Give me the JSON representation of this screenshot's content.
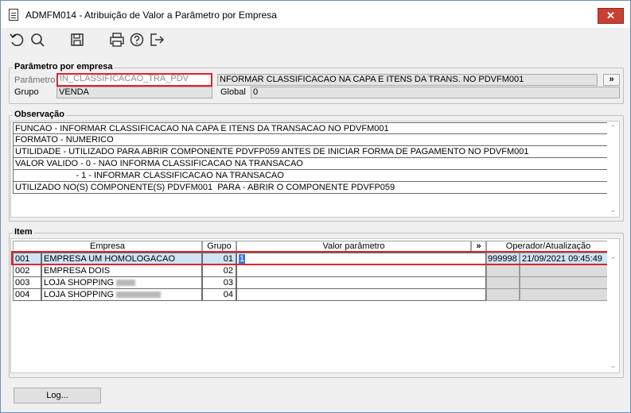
{
  "window": {
    "title": "ADMFM014 - Atribuição de Valor a Parâmetro por Empresa",
    "close_label": "✕"
  },
  "toolbar": {
    "icons": [
      "undo-icon",
      "search-icon",
      "save-icon",
      "print-icon",
      "help-icon",
      "exit-icon"
    ]
  },
  "parametro_section": {
    "title": "Parâmetro por empresa",
    "parametro_label": "Parâmetro",
    "parametro_value": "IN_CLASSIFICACAO_TRA_PDV",
    "description": "NFORMAR CLASSIFICACAO NA CAPA E ITENS DA TRANS. NO PDVFM001",
    "more_label": "»",
    "grupo_label": "Grupo",
    "grupo_value": "VENDA",
    "global_label": "Global",
    "global_value": "0"
  },
  "observacao": {
    "title": "Observação",
    "lines": [
      "FUNCAO - INFORMAR CLASSIFICACAO NA CAPA E ITENS DA TRANSACAO NO PDVFM001",
      "FORMATO - NUMERICO",
      "UTILIDADE - UTILIZADO PARA ABRIR COMPONENTE PDVFP059 ANTES DE INICIAR FORMA DE PAGAMENTO NO PDVFM001",
      "VALOR VALIDO - 0 - NAO INFORMA CLASSIFICACAO NA TRANSACAO",
      "                         - 1 - INFORMAR CLASSIFICACAO NA TRANSACAO",
      "UTILIZADO NO(S) COMPONENTE(S) PDVFM001  PARA - ABRIR O COMPONENTE PDVFP059"
    ]
  },
  "item": {
    "title": "Item",
    "headers": {
      "empresa": "Empresa",
      "grupo": "Grupo",
      "valor": "Valor parâmetro",
      "more": "»",
      "operador": "Operador/Atualização"
    },
    "rows": [
      {
        "code": "001",
        "name": "EMPRESA UM HOMOLOGACAO",
        "grupo": "01",
        "valor": "1",
        "operador": "999998",
        "data": "21/09/2021 09:45:49"
      },
      {
        "code": "002",
        "name": "EMPRESA DOIS",
        "grupo": "02",
        "valor": "",
        "operador": "",
        "data": ""
      },
      {
        "code": "003",
        "name": "LOJA SHOPPING",
        "grupo": "03",
        "valor": "",
        "operador": "",
        "data": ""
      },
      {
        "code": "004",
        "name": "LOJA SHOPPING",
        "grupo": "04",
        "valor": "",
        "operador": "",
        "data": ""
      }
    ]
  },
  "footer": {
    "log_label": "Log..."
  },
  "colors": {
    "highlight": "#d9262c",
    "close": "#c84031",
    "selected_row": "#cfe4f7"
  }
}
